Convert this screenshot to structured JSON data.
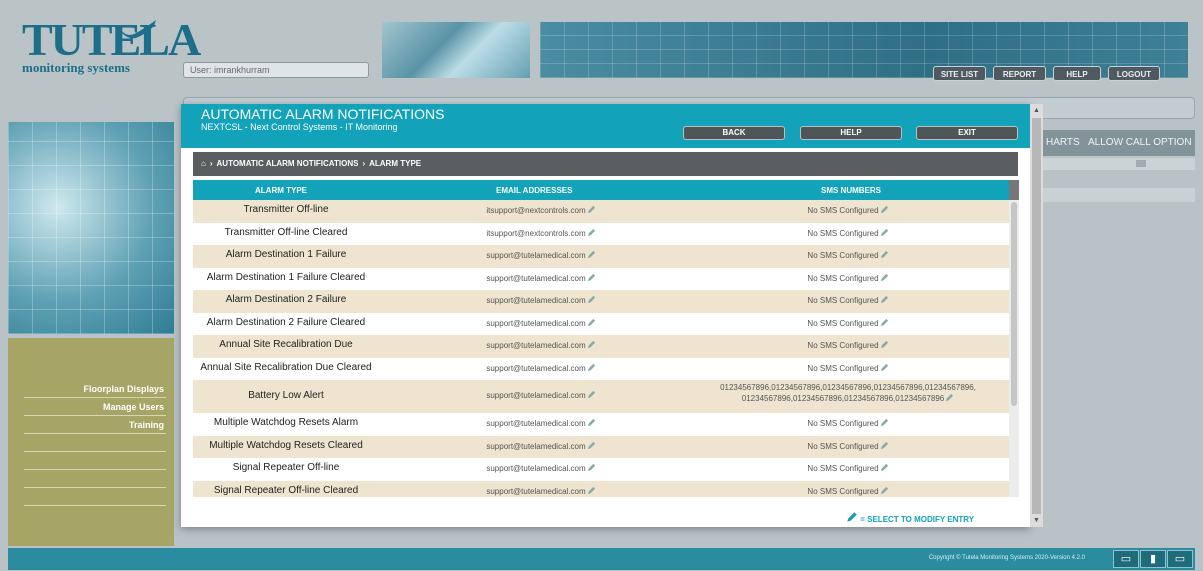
{
  "brand": {
    "name": "TUTELA",
    "tagline": "monitoring systems"
  },
  "user_label": "User: imrankhurram",
  "top_nav": {
    "site_list": "SITE LIST",
    "report": "REPORT",
    "help": "HELP",
    "logout": "LOGOUT"
  },
  "sidebar": {
    "items": [
      "Floorplan Displays",
      "Manage Users",
      "Training"
    ]
  },
  "background_table": {
    "col_charts": "HARTS",
    "col_allow": "ALLOW CALL OPTION"
  },
  "footer": {
    "copyright": "Copyright © Tutela Monitoring Systems 2020-Version 4.2.0"
  },
  "modal": {
    "title": "AUTOMATIC ALARM NOTIFICATIONS",
    "subtitle": "NEXTCSL - Next Control Systems - IT Monitoring",
    "buttons": {
      "back": "BACK",
      "help": "HELP",
      "exit": "EXIT"
    },
    "breadcrumb": {
      "home_icon": "home-icon",
      "section": "AUTOMATIC ALARM NOTIFICATIONS",
      "page": "ALARM TYPE"
    },
    "columns": {
      "type": "ALARM TYPE",
      "email": "EMAIL ADDRESSES",
      "sms": "SMS NUMBERS"
    },
    "rows": [
      {
        "type": "Transmitter Off-line",
        "email": "itsupport@nextcontrols.com",
        "sms": "No SMS Configured"
      },
      {
        "type": "Transmitter Off-line Cleared",
        "email": "itsupport@nextcontrols.com",
        "sms": "No SMS Configured"
      },
      {
        "type": "Alarm Destination 1 Failure",
        "email": "support@tutelamedical.com",
        "sms": "No SMS Configured"
      },
      {
        "type": "Alarm Destination 1 Failure Cleared",
        "email": "support@tutelamedical.com",
        "sms": "No SMS Configured"
      },
      {
        "type": "Alarm Destination 2 Failure",
        "email": "support@tutelamedical.com",
        "sms": "No SMS Configured"
      },
      {
        "type": "Alarm Destination 2 Failure Cleared",
        "email": "support@tutelamedical.com",
        "sms": "No SMS Configured"
      },
      {
        "type": "Annual Site Recalibration Due",
        "email": "support@tutelamedical.com",
        "sms": "No SMS Configured"
      },
      {
        "type": "Annual Site Recalibration Due Cleared",
        "email": "support@tutelamedical.com",
        "sms": "No SMS Configured"
      },
      {
        "type": "Battery Low Alert",
        "email": "support@tutelamedical.com",
        "sms": "01234567896,01234567896,01234567896,01234567896,01234567896,",
        "sms_line2": "01234567896,01234567896,01234567896,01234567896"
      },
      {
        "type": "Multiple Watchdog Resets Alarm",
        "email": "support@tutelamedical.com",
        "sms": "No SMS Configured"
      },
      {
        "type": "Multiple Watchdog Resets Cleared",
        "email": "support@tutelamedical.com",
        "sms": "No SMS Configured"
      },
      {
        "type": "Signal Repeater Off-line",
        "email": "support@tutelamedical.com",
        "sms": "No SMS Configured"
      },
      {
        "type": "Signal Repeater Off-line Cleared",
        "email": "support@tutelamedical.com",
        "sms": "No SMS Configured"
      }
    ],
    "legend": "= SELECT TO MODIFY ENTRY"
  },
  "colors": {
    "accent": "#12a3ba",
    "row_alt": "#eee4cf",
    "nav_olive": "#a6a566",
    "footer": "#2b8c9f"
  }
}
